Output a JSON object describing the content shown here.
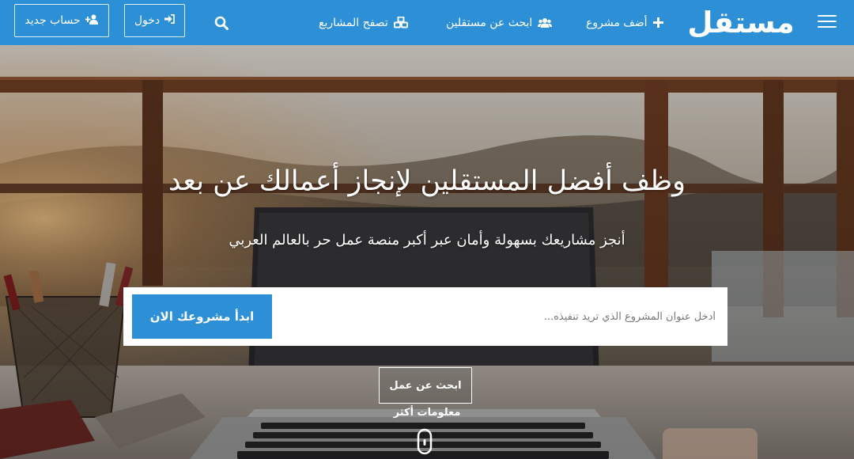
{
  "nav": {
    "logo": "مستقل",
    "add_project": "أضف مشروع",
    "find_freelancers": "ابحث عن مستقلين",
    "browse_projects": "تصفح المشاريع",
    "login": "دخول",
    "register": "حساب جديد",
    "icons": {
      "menu": "hamburger-menu-icon",
      "add": "plus-icon",
      "freelancers": "users-icon",
      "browse": "cubes-icon",
      "search": "search-icon",
      "login": "sign-in-icon",
      "register": "user-plus-icon"
    }
  },
  "hero": {
    "title": "وظف أفضل المستقلين لإنجاز أعمالك عن بعد",
    "subtitle": "أنجز مشاريعك بسهولة وأمان عبر أكبر منصة عمل حر بالعالم العربي",
    "search_placeholder": "أدخل عنوان المشروع الذي تريد تنفيذه...",
    "start_button": "ابدأ مشروعك الان",
    "find_work_button": "ابحث عن عمل",
    "more_info": "معلومات أكثر",
    "scroll_icon": "mouse-scroll-icon"
  },
  "colors": {
    "primary": "#2d8fd5",
    "text_on_primary": "#ffffff"
  }
}
